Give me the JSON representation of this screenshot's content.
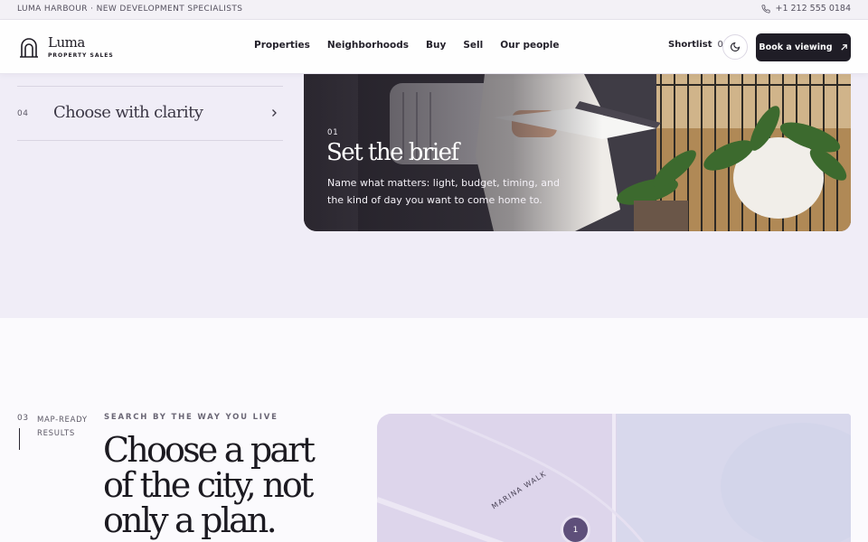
{
  "topbar": {
    "tagline": "LUMA HARBOUR · NEW DEVELOPMENT SPECIALISTS",
    "phone": "+1 212 555 0184",
    "phone_icon": "phone-icon"
  },
  "header": {
    "logo_word": "Luma",
    "logo_sub": "PROPERTY SALES",
    "logo_icon": "arch-logo-icon",
    "nav": [
      "Properties",
      "Neighborhoods",
      "Buy",
      "Sell",
      "Our people"
    ],
    "shortlist_label": "Shortlist",
    "shortlist_count": "0",
    "theme_icon": "moon-icon",
    "cta_label": "Book a viewing",
    "cta_icon": "arrow-up-right-icon"
  },
  "steps": {
    "row": {
      "number": "04",
      "title": "Choose with clarity",
      "icon": "chevron-right-icon"
    },
    "active": {
      "number": "01",
      "title": "Set the brief",
      "description": "Name what matters: light, budget, timing, and the kind of day you want to come home to."
    }
  },
  "search_section": {
    "index": "03",
    "index_label": "MAP-READY RESULTS",
    "eyebrow": "SEARCH BY THE WAY YOU LIVE",
    "headline": "Choose a part of the city, not only a plan.",
    "map": {
      "street_label": "MARINA WALK",
      "pin_label": "1"
    }
  },
  "colors": {
    "accent": "#1f1d26",
    "section_bg": "#f0edf7",
    "map_bg": "#dcd4ea",
    "pin": "#5e4f7a"
  }
}
